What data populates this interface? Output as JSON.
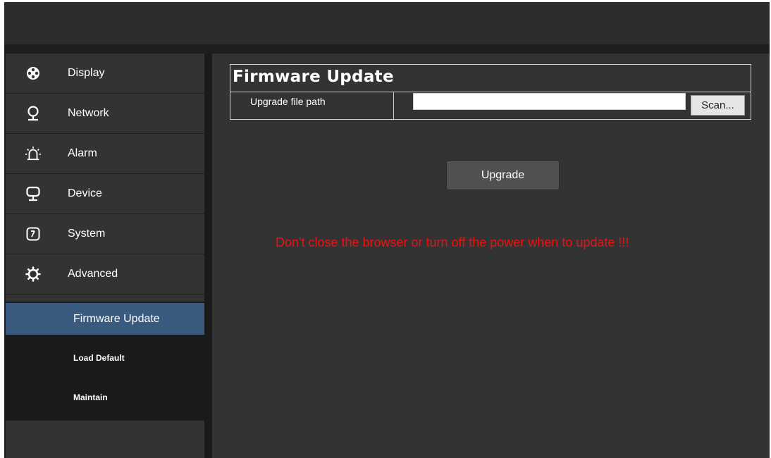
{
  "sidebar": {
    "items": [
      {
        "label": "Display",
        "icon": "display-icon"
      },
      {
        "label": "Network",
        "icon": "network-icon"
      },
      {
        "label": "Alarm",
        "icon": "alarm-icon"
      },
      {
        "label": "Device",
        "icon": "device-icon"
      },
      {
        "label": "System",
        "icon": "system-icon"
      },
      {
        "label": "Advanced",
        "icon": "gear-icon"
      }
    ],
    "submenu": [
      {
        "label": "Firmware Update",
        "active": true
      },
      {
        "label": "Load Default",
        "active": false
      },
      {
        "label": "Maintain",
        "active": false
      }
    ]
  },
  "main": {
    "section_title": "Firmware Update",
    "file_path_label": "Upgrade file path",
    "file_path_value": "",
    "scan_button": "Scan...",
    "upgrade_button": "Upgrade",
    "warning": "Don't close the browser or turn off the power when to update !!!"
  },
  "colors": {
    "background": "#333333",
    "active_item": "#3a5a80",
    "warning": "#ee1111"
  }
}
